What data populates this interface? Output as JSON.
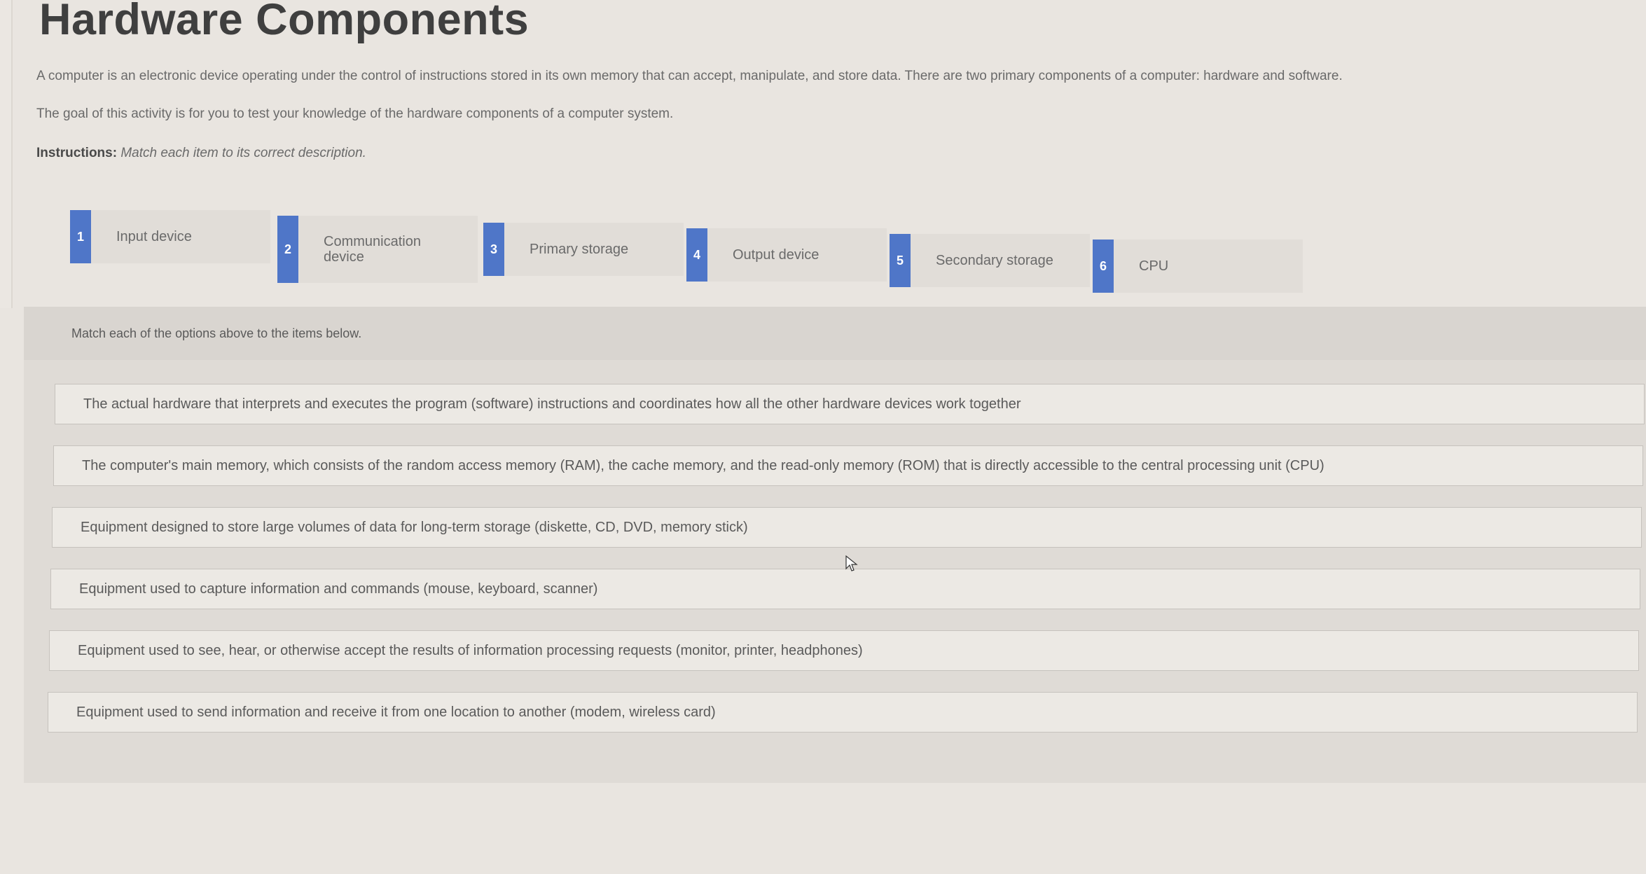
{
  "title": "Hardware Components",
  "intro": "A computer is an electronic device operating under the control of instructions stored in its own memory that can accept, manipulate, and store data. There are two primary components of a computer: hardware and software.",
  "goal": "The goal of this activity is for you to test your knowledge of the hardware components of a computer system.",
  "instructions": {
    "label": "Instructions:",
    "text": "Match each item to its correct description."
  },
  "options": [
    {
      "number": "1",
      "label": "Input device"
    },
    {
      "number": "2",
      "label": "Communication device"
    },
    {
      "number": "3",
      "label": "Primary storage"
    },
    {
      "number": "4",
      "label": "Output device"
    },
    {
      "number": "5",
      "label": "Secondary storage"
    },
    {
      "number": "6",
      "label": "CPU"
    }
  ],
  "match_header": "Match each of the options above to the items below.",
  "match_items": [
    "The actual hardware that interprets and executes the program (software) instructions and coordinates how all the other hardware devices work together",
    "The computer's main memory, which consists of the random access memory (RAM), the cache memory, and the read-only memory (ROM) that is directly accessible to the central processing unit (CPU)",
    "Equipment designed to store large volumes of data for long-term storage (diskette, CD, DVD, memory stick)",
    "Equipment used to capture information and commands (mouse, keyboard, scanner)",
    "Equipment used to see, hear, or otherwise accept the results of information processing requests (monitor, printer, headphones)",
    "Equipment used to send information and receive it from one location to another (modem, wireless card)"
  ],
  "colors": {
    "badge": "#4f76c8",
    "background": "#e9e5e0"
  }
}
